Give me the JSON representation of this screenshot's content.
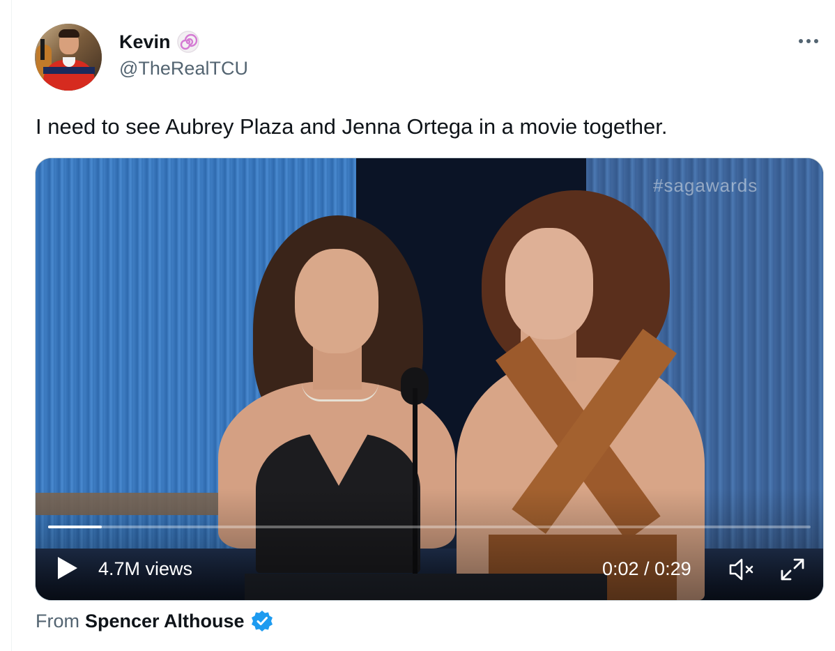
{
  "author": {
    "display_name": "Kevin",
    "handle": "@TheRealTCU",
    "badge": "spiral-badge-icon"
  },
  "tweet": {
    "text": "I need to see Aubrey Plaza and Jenna Ortega in a movie together."
  },
  "video": {
    "watermark": "#sagawards",
    "views": "4.7M views",
    "time": "0:02 / 0:29",
    "progress_fraction": 0.07,
    "muted": true
  },
  "source": {
    "prefix": "From",
    "name": "Spencer Althouse",
    "verified": true
  },
  "colors": {
    "text_primary": "#0f1419",
    "text_secondary": "#536471",
    "verified_blue": "#1d9bf0",
    "badge_pink": "#d47ad3"
  }
}
